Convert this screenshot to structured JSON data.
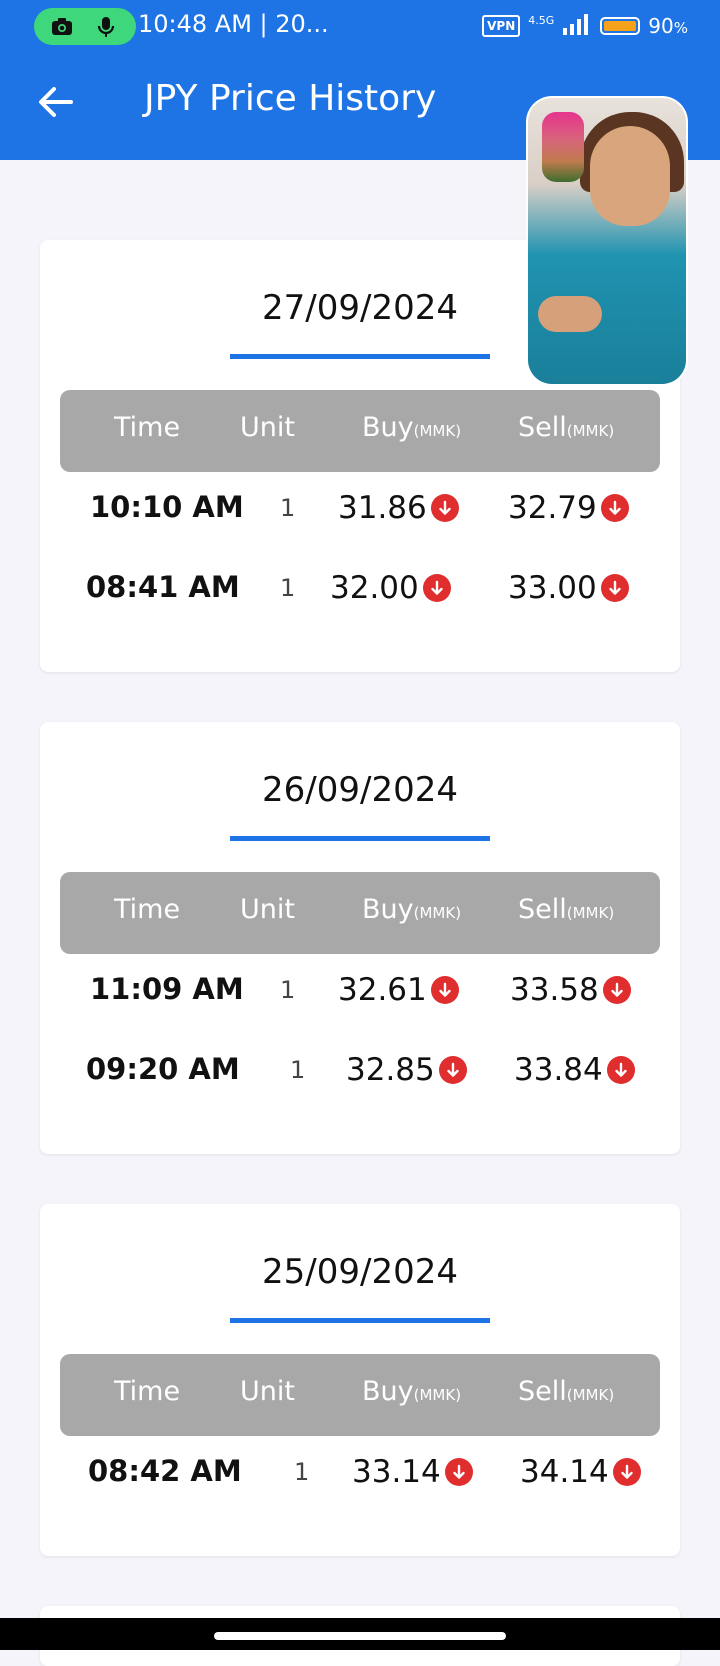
{
  "status_bar": {
    "time": "10:48 AM | 20...",
    "vpn": "VPN",
    "network": "4.5G",
    "battery": "90",
    "battery_unit": "%"
  },
  "app_bar": {
    "title": "JPY Price History",
    "back_icon": "arrow-left-icon"
  },
  "table_headers": {
    "time": "Time",
    "unit": "Unit",
    "buy": "Buy",
    "buy_unit": "(MMK)",
    "sell": "Sell",
    "sell_unit": "(MMK)"
  },
  "colors": {
    "primary": "#1e74e4",
    "header_bg": "#a8a8a8",
    "down": "#e02d2d",
    "rec_pill": "#3ed77b"
  },
  "cards": [
    {
      "date": "27/09/2024",
      "rows": [
        {
          "time": "10:10 AM",
          "unit": "1",
          "buy": "31.86",
          "sell": "32.79",
          "trend": "down"
        },
        {
          "time": "08:41 AM",
          "unit": "1",
          "buy": "32.00",
          "sell": "33.00",
          "trend": "down"
        }
      ]
    },
    {
      "date": "26/09/2024",
      "rows": [
        {
          "time": "11:09 AM",
          "unit": "1",
          "buy": "32.61",
          "sell": "33.58",
          "trend": "down"
        },
        {
          "time": "09:20 AM",
          "unit": "1",
          "buy": "32.85",
          "sell": "33.84",
          "trend": "down"
        }
      ]
    },
    {
      "date": "25/09/2024",
      "rows": [
        {
          "time": "08:42 AM",
          "unit": "1",
          "buy": "33.14",
          "sell": "34.14",
          "trend": "down"
        }
      ]
    }
  ]
}
